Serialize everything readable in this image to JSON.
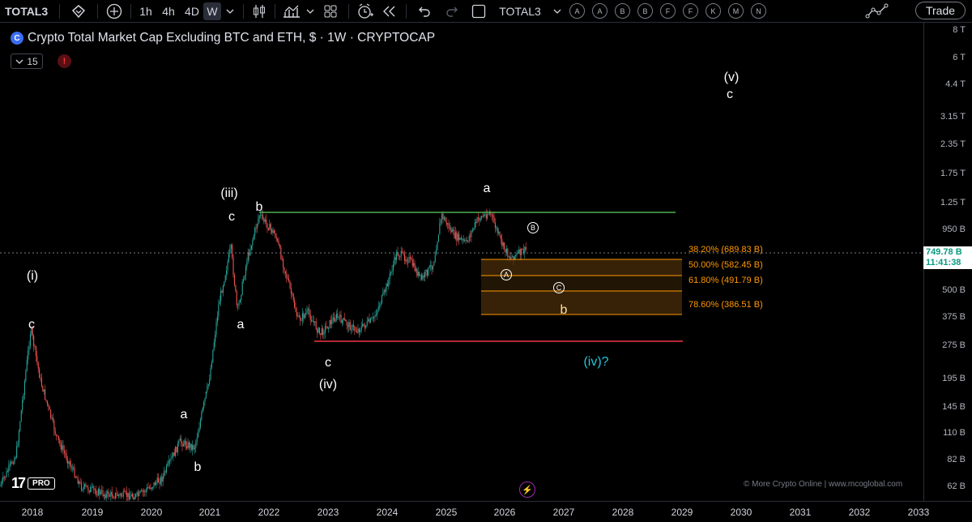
{
  "toolbar": {
    "symbol": "TOTAL3",
    "intervals": [
      "1h",
      "4h",
      "4D",
      "W"
    ],
    "active_interval": "W",
    "compare_symbol": "TOTAL3",
    "circle_buttons": [
      "A",
      "A",
      "B",
      "B",
      "F",
      "F",
      "K",
      "M",
      "N"
    ],
    "trade_label": "Trade"
  },
  "legend": {
    "title": "Crypto Total Market Cap Excluding BTC and ETH, $ · 1W · CRYPTOCAP",
    "interval_box": "15",
    "logo_icon": "C",
    "alert_icon": "!"
  },
  "price_axis": {
    "ticks": [
      "8 T",
      "6 T",
      "4.4 T",
      "3.15 T",
      "2.35 T",
      "1.75 T",
      "1.25 T",
      "950 B",
      "500 B",
      "375 B",
      "275 B",
      "195 B",
      "145 B",
      "110 B",
      "82 B",
      "62 B"
    ],
    "last_price": "749.78 B",
    "countdown": "11:41:38"
  },
  "time_axis": {
    "ticks": [
      "2018",
      "2019",
      "2020",
      "2021",
      "2022",
      "2023",
      "2024",
      "2025",
      "2026",
      "2027",
      "2028",
      "2029",
      "2030",
      "2031",
      "2032",
      "2033"
    ]
  },
  "fib_levels": [
    {
      "label": "38.20% (689.83 B)"
    },
    {
      "label": "50.00% (582.45 B)"
    },
    {
      "label": "61.80% (491.79 B)"
    },
    {
      "label": "78.60% (386.51 B)"
    }
  ],
  "wave_labels": {
    "w_i": "(i)",
    "w_i_c": "c",
    "w_a1": "a",
    "w_b1": "b",
    "w_iii": "(iii)",
    "w_iii_c": "c",
    "w_iii_b": "b",
    "w_iii_a": "a",
    "w_iv_c": "c",
    "w_iv": "(iv)",
    "w_a2": "a",
    "w_circ_a": "A",
    "w_circ_b": "B",
    "w_circ_c": "C",
    "w_b2": "b",
    "w_iv_q": "(iv)?",
    "w_v": "(v)",
    "w_v_c": "c"
  },
  "footer": {
    "tv_mark": "17",
    "pro": "PRO",
    "watermark": "© More Crypto Online  |  www.mcoglobal.com",
    "flash_icon": "⚡"
  },
  "colors": {
    "up": "#26a69a",
    "down": "#ef5350",
    "resistance": "#4caf50",
    "support": "#f23645",
    "fib": "#ff9800"
  }
}
